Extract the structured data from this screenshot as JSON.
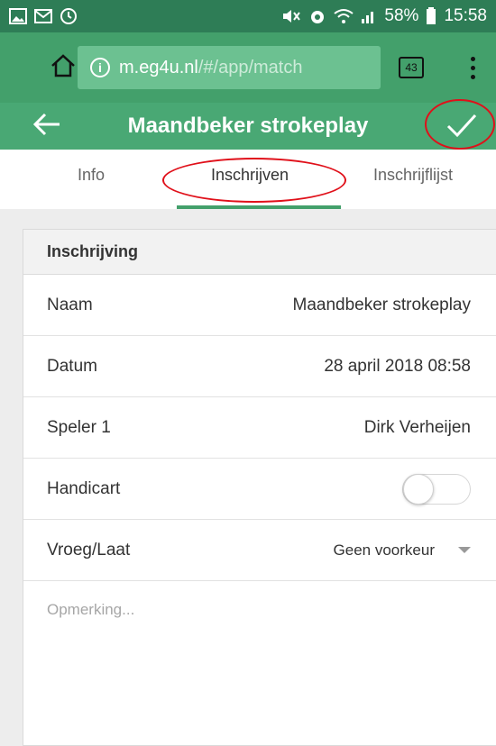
{
  "status_bar": {
    "battery": "58%",
    "time": "15:58",
    "icons_left": [
      "image-icon",
      "mail-icon",
      "alarm-icon"
    ],
    "icons_right": [
      "mute-icon",
      "alarm-icon",
      "wifi-icon",
      "signal-icon",
      "battery-icon"
    ]
  },
  "browser": {
    "url_host": "m.eg4u.nl",
    "url_path": "/#/app/match",
    "tabs_count": "43"
  },
  "header": {
    "title": "Maandbeker strokeplay"
  },
  "tabs": [
    {
      "label": "Info"
    },
    {
      "label": "Inschrijven"
    },
    {
      "label": "Inschrijflijst"
    }
  ],
  "form": {
    "section_title": "Inschrijving",
    "fields": [
      {
        "label": "Naam",
        "value": "Maandbeker strokeplay"
      },
      {
        "label": "Datum",
        "value": "28 april 2018 08:58"
      },
      {
        "label": "Speler 1",
        "value": "Dirk Verheijen"
      },
      {
        "label": "Handicart",
        "toggle_on": false
      },
      {
        "label": "Vroeg/Laat",
        "selected": "Geen voorkeur"
      }
    ],
    "remark_placeholder": "Opmerking..."
  },
  "colors": {
    "status_bar": "#2e7d56",
    "browser_bar": "#43a06b",
    "app_header": "#49a874",
    "accent": "#43a06b",
    "annotation": "#e0101a"
  }
}
